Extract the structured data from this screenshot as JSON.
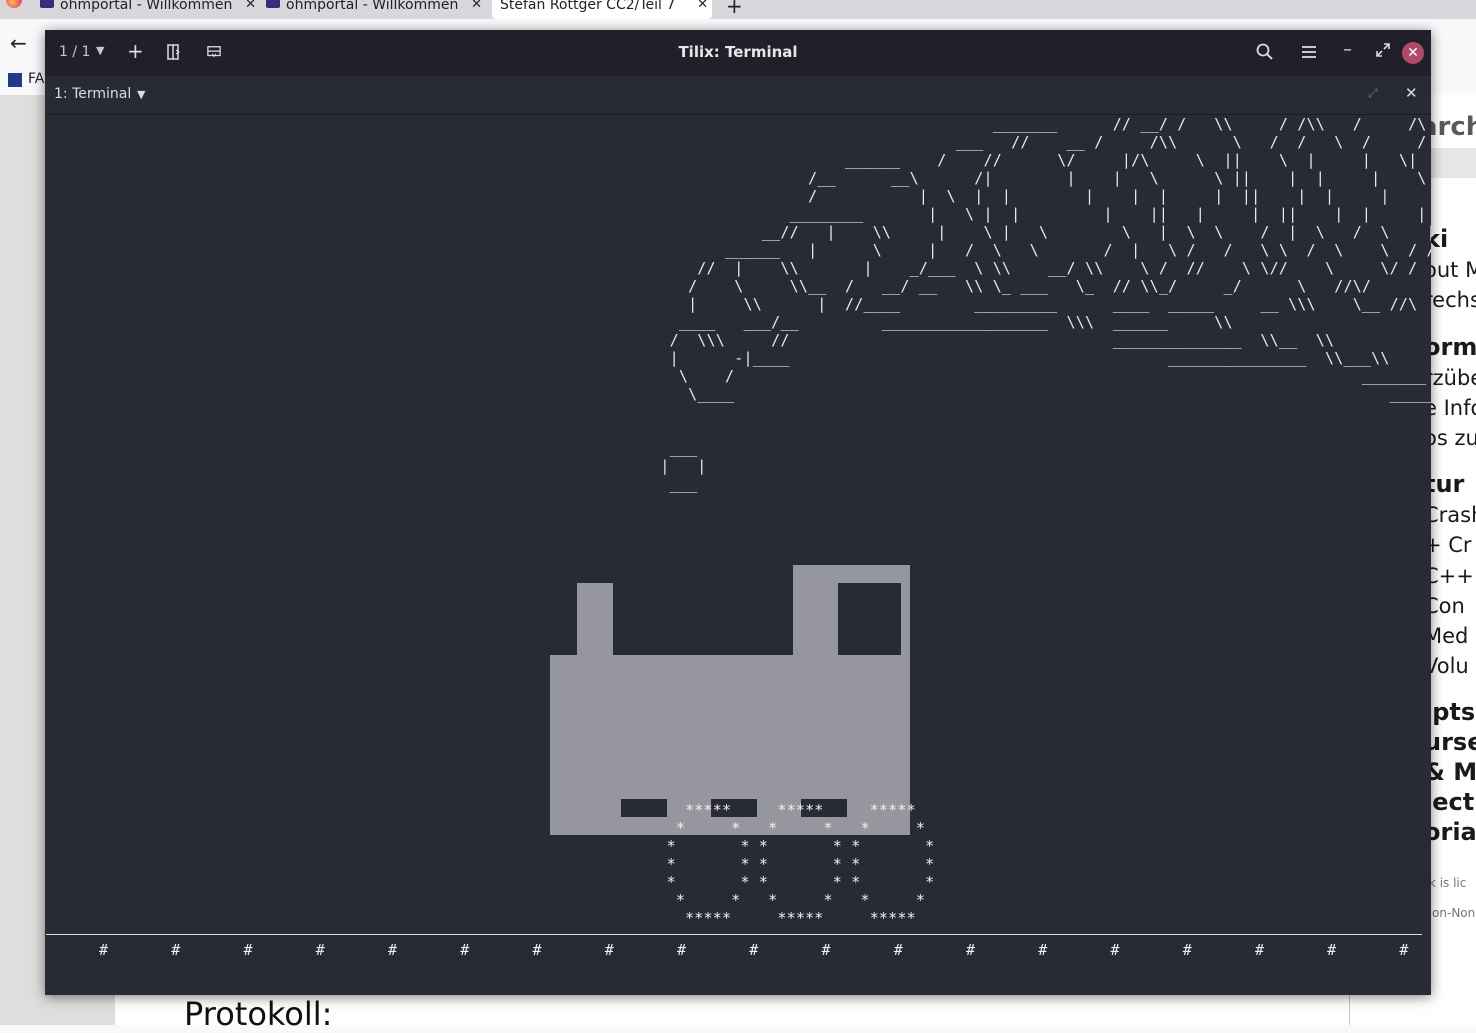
{
  "browser": {
    "tabs": [
      {
        "label": "ohmportal - Willkommen"
      },
      {
        "label": "ohmportal - Willkommen"
      },
      {
        "label": "Stefan Röttger CC2/Teil 7"
      }
    ],
    "bookmark_label": "FA",
    "page": {
      "search_fragment": "arch",
      "sidebar_lines": [
        "ki",
        "out M",
        "rechs",
        "orm",
        "rzübe",
        "e Info",
        "os zu",
        "tur",
        "Crash",
        "+ Cr",
        "C++",
        " Con",
        " Med",
        " Volu",
        "ipts",
        "urse",
        " & M",
        "ject",
        "oria",
        "rk is lic",
        "tion-Non"
      ],
      "heading": "Protokoll:"
    }
  },
  "tilix": {
    "session_counter": "1 / 1",
    "window_title": "Tilix: Terminal",
    "terminal_title": "1: Terminal",
    "colors": {
      "titlebar": "#1f2029",
      "background": "#282a36",
      "close_button": "#b04a6a",
      "locomotive": "#96969e"
    }
  },
  "terminal": {
    "ascii_smoke": "                                          _______      // __/ /   \\\\     / /\\\\   /     /\\ \\\n                                      ___   //    __ /     /\\\\      \\   /  /   \\  /     / \\ \\\n                          ______    /    //      \\/     |/\\     \\  ||    \\  |     |   \\|\n                      /__      __\\      /|        |    |   \\      \\ ||    |  |     |    \\\n                      /           |  \\  |  |        |    |  |     |  ||    |  |     |     |\n                    ________       |   \\ |  |         |    ||   |     |  ||    |  |     |     |\n                 __//   |    \\\\     |    \\ |   \\        \\   |  \\  \\    /  |  \\   /  \\    |   /\n             ______   |      \\     |   /  \\   \\       /  |   \\ /   /   \\ \\  /  \\    \\  / /\n          //  |    \\\\       |    _/___  \\ \\\\    __/ \\\\    \\ /  //    \\ \\//    \\     \\/ /\n         /    \\     \\\\__  /   __/ __   \\\\ \\_ ___   \\_  // \\\\_/     _/      \\   //\\/\n         |     \\\\      |  //____        _________      ____  _____     __ \\\\\\    \\__ //\\\n        ____   ___/__         __________________  \\\\\\  ______     \\\\\n       /  \\\\\\     //                                   ______________  \\\\__  \\\\\n       |      -|____                                         _______________  \\\\___\\\\\n        \\    /                                                                    _______\n         \\____                                                                       _____\n\n\n       ___\n      |   |\n       ___",
    "wheels": "         *****     *****     *****\n        *     *   *     *   *     *\n       *       * *       * *       *\n       *       * *       * *       *\n       *       * *       * *       *\n        *     *   *     *   *     *\n         *****     *****     *****",
    "track_ties": "#       #       #       #       #       #       #       #       #       #       #       #       #       #       #       #       #       #       #"
  }
}
